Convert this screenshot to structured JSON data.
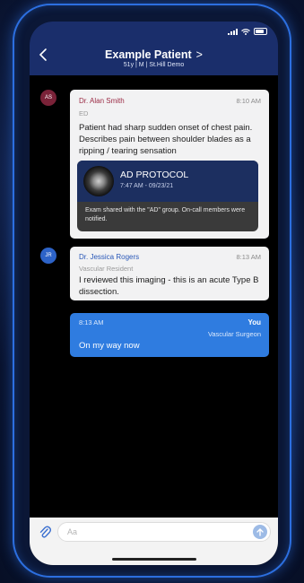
{
  "header": {
    "title": "Example Patient",
    "title_chevron": ">",
    "subtitle": "51y  |  M  |  St.Hill Demo"
  },
  "messages": [
    {
      "avatar": "AS",
      "avatar_color": "#7a2238",
      "sender": "Dr. Alan Smith",
      "sender_color": "#9b2b45",
      "time": "8:10 AM",
      "role": "ED",
      "text": "Patient had sharp sudden onset of chest pain. Describes pain between shoulder blades as a ripping / tearing sensation",
      "attachment": {
        "title": "AD PROTOCOL",
        "meta": "7:47 AM - 09/23/21",
        "note": "Exam shared with the \"AD\" group. On-call members were notified."
      }
    },
    {
      "avatar": "JR",
      "avatar_color": "#2d63c8",
      "sender": "Dr. Jessica Rogers",
      "sender_color": "#2a58b8",
      "time": "8:13 AM",
      "role": "Vascular Resident",
      "text": "I reviewed this imaging - this is an acute Type B dissection."
    },
    {
      "sender": "You",
      "time": "8:13 AM",
      "role": "Vascular Surgeon",
      "text": "On my way now",
      "bubble_color": "#2f7ce0"
    }
  ],
  "composer": {
    "placeholder": "Aa"
  },
  "icons": {
    "back": "chevron-left-icon",
    "attach": "paperclip-icon",
    "send": "arrow-up-icon",
    "signal": "signal-icon",
    "wifi": "wifi-icon",
    "battery": "battery-icon"
  },
  "colors": {
    "header": "#1a2e6b",
    "accent": "#2f7ce0",
    "frame": "#2c6fe0"
  }
}
